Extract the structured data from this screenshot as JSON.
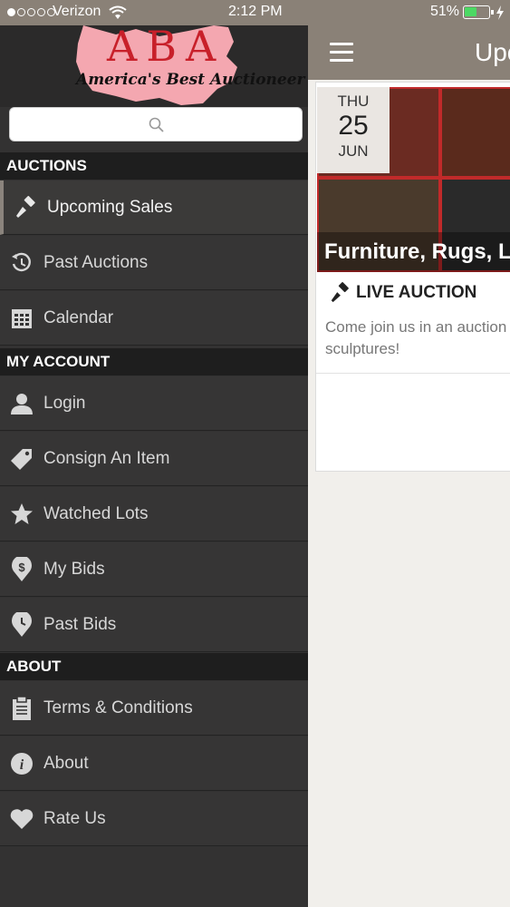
{
  "status_bar": {
    "carrier": "Verizon",
    "time": "2:12 PM",
    "battery": "51%",
    "battery_level": 0.51
  },
  "logo": {
    "title": "ABA",
    "tagline": "America's Best Auctioneer"
  },
  "search": {
    "placeholder": ""
  },
  "sidebar": {
    "sections": [
      {
        "title": "AUCTIONS",
        "items": [
          {
            "label": "Upcoming Sales",
            "icon": "gavel-icon"
          },
          {
            "label": "Past Auctions",
            "icon": "history-icon"
          },
          {
            "label": "Calendar",
            "icon": "calendar-icon"
          }
        ]
      },
      {
        "title": "MY ACCOUNT",
        "items": [
          {
            "label": "Login",
            "icon": "user-icon"
          },
          {
            "label": "Consign An Item",
            "icon": "tag-icon"
          },
          {
            "label": "Watched Lots",
            "icon": "star-icon"
          },
          {
            "label": "My Bids",
            "icon": "dollar-pin-icon"
          },
          {
            "label": "Past Bids",
            "icon": "clock-pin-icon"
          }
        ]
      },
      {
        "title": "ABOUT",
        "items": [
          {
            "label": "Terms & Conditions",
            "icon": "clipboard-icon"
          },
          {
            "label": "About",
            "icon": "info-icon"
          },
          {
            "label": "Rate Us",
            "icon": "heart-icon"
          }
        ]
      }
    ]
  },
  "main": {
    "title": "Upc",
    "card": {
      "dow": "THU",
      "day": "25",
      "month": "JUN",
      "title": "Furniture, Rugs, L",
      "type": "LIVE AUCTION",
      "description": "Come join us in an auction sculptures!"
    }
  },
  "colors": {
    "accent": "#8a8177",
    "sidebar": "#333232",
    "section": "#1e1e1e",
    "logo_red": "#c8202a"
  }
}
